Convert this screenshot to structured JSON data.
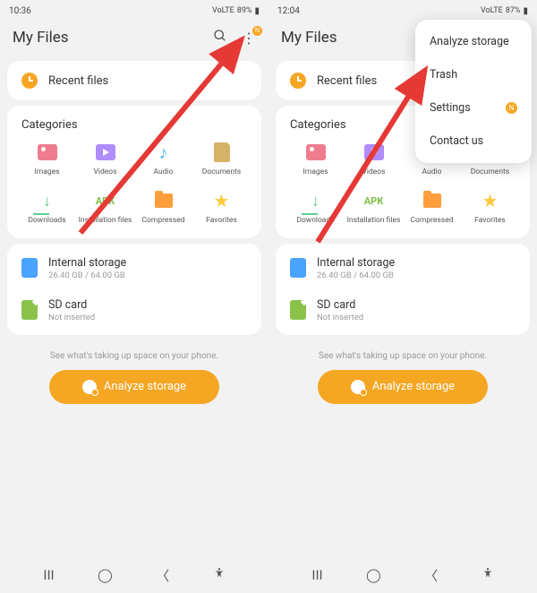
{
  "left": {
    "status": {
      "time": "10:36",
      "battery": "89%",
      "sig": "VoLTE"
    },
    "title": "My Files",
    "recent_label": "Recent files",
    "cats_title": "Categories",
    "cats": [
      {
        "label": "Images"
      },
      {
        "label": "Videos"
      },
      {
        "label": "Audio"
      },
      {
        "label": "Documents"
      },
      {
        "label": "Downloads"
      },
      {
        "label": "Installation files"
      },
      {
        "label": "Compressed"
      },
      {
        "label": "Favorites"
      }
    ],
    "storage": {
      "internal": {
        "name": "Internal storage",
        "sub": "26.40 GB / 64.00 GB"
      },
      "sd": {
        "name": "SD card",
        "sub": "Not inserted"
      }
    },
    "hint": "See what's taking up space on your phone.",
    "analyze": "Analyze storage"
  },
  "right": {
    "status": {
      "time": "12:04",
      "battery": "87%",
      "sig": "VoLTE"
    },
    "title": "My Files",
    "recent_label": "Recent files",
    "cats_title": "Categories",
    "cats": [
      {
        "label": "Images"
      },
      {
        "label": "Videos"
      },
      {
        "label": "Audio"
      },
      {
        "label": "Documents"
      },
      {
        "label": "Downloads"
      },
      {
        "label": "Installation files"
      },
      {
        "label": "Compressed"
      },
      {
        "label": "Favorites"
      }
    ],
    "storage": {
      "internal": {
        "name": "Internal storage",
        "sub": "26.40 GB / 64.00 GB"
      },
      "sd": {
        "name": "SD card",
        "sub": "Not inserted"
      }
    },
    "hint": "See what's taking up space on your phone.",
    "analyze": "Analyze storage",
    "menu": {
      "items": [
        {
          "label": "Analyze storage"
        },
        {
          "label": "Trash"
        },
        {
          "label": "Settings",
          "badge": "N"
        },
        {
          "label": "Contact us"
        }
      ]
    }
  }
}
